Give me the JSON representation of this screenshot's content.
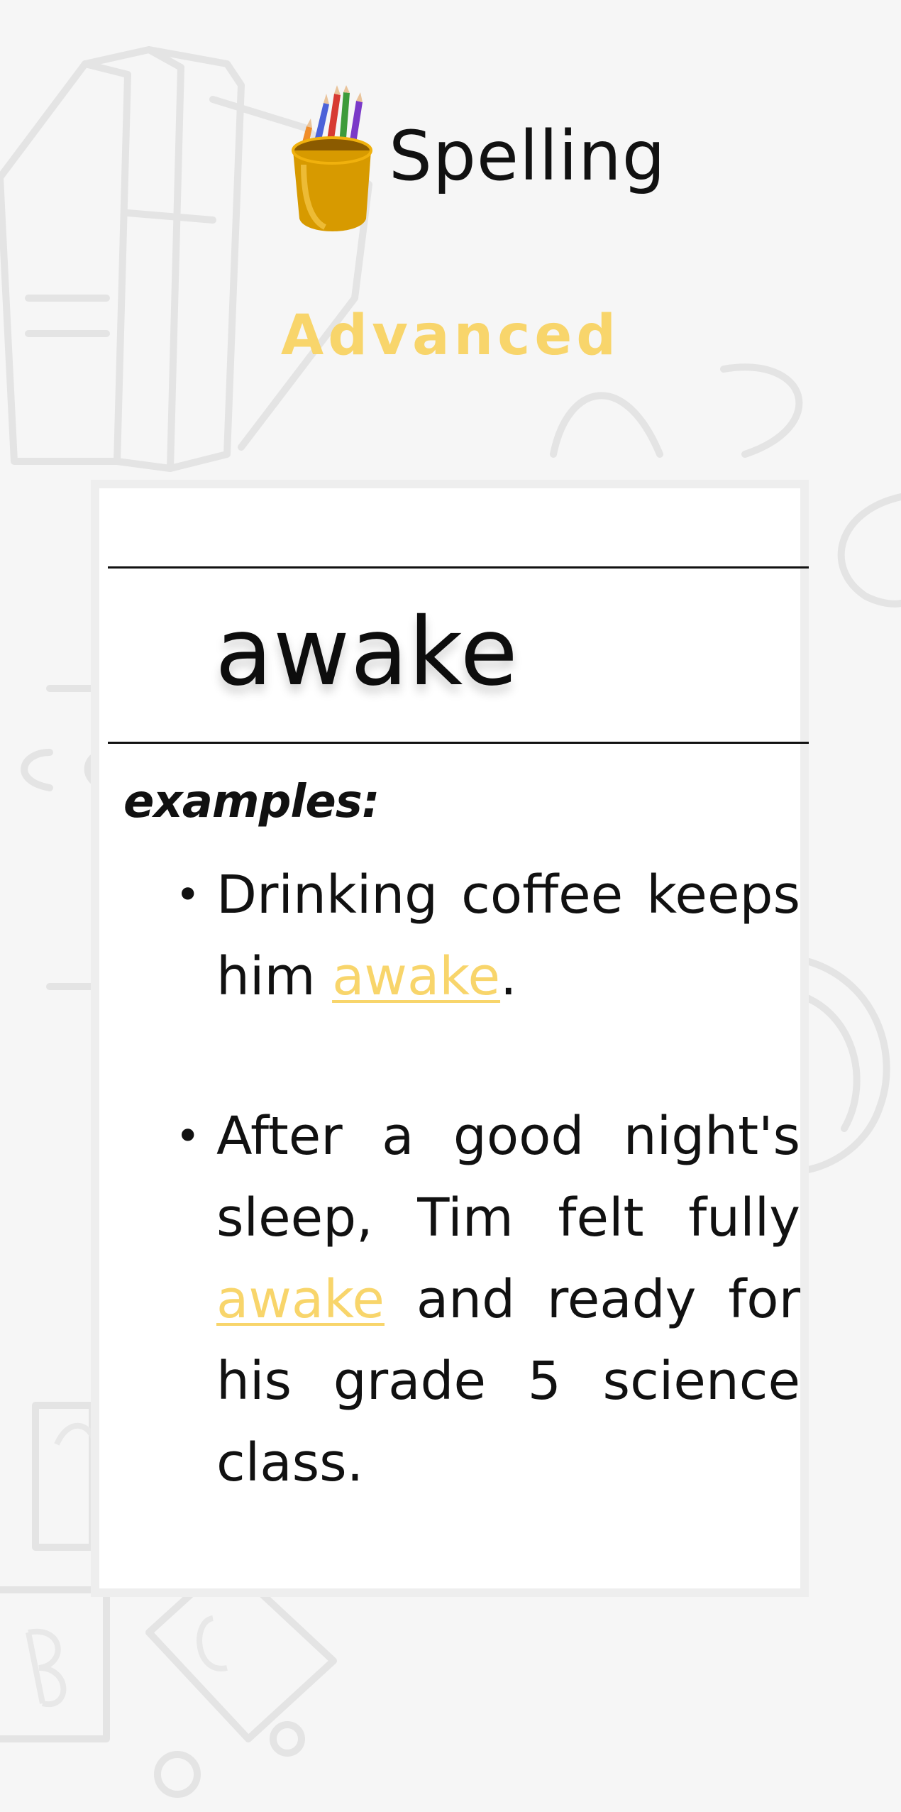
{
  "header": {
    "icon": "pencil-cup-icon",
    "title": "Spelling",
    "level": "Advanced"
  },
  "card": {
    "word": "awake",
    "examples_heading": "examples:",
    "examples": [
      {
        "before": "Drinking coffee keeps him ",
        "highlight": "awake",
        "after": "."
      },
      {
        "before": "After a good night's sleep, Tim felt fully ",
        "highlight": "awake",
        "after": " and ready for his grade 5 science class."
      }
    ]
  },
  "colors": {
    "background": "#f6f6f6",
    "accent": "#f8d56b",
    "text": "#111111",
    "card_border": "#eeeeee"
  }
}
